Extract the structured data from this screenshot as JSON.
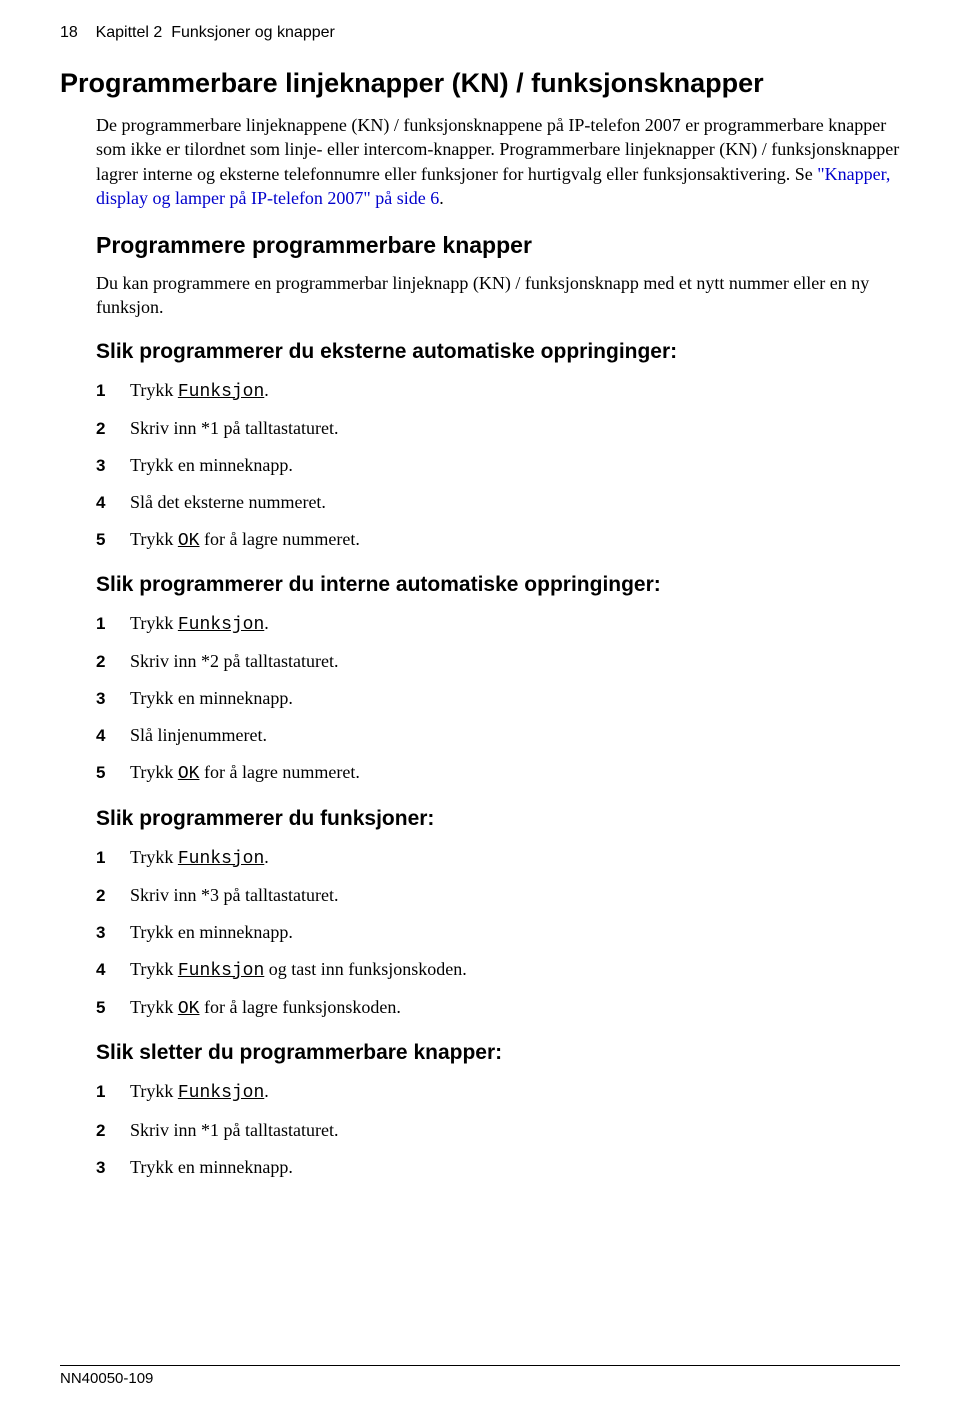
{
  "header": {
    "page_num": "18",
    "chapter": "Kapittel 2",
    "chapter_title": "Funksjoner og knapper"
  },
  "h1": "Programmerbare linjeknapper (KN) / funksjonsknapper",
  "intro": {
    "t1": "De programmerbare linjeknappene (KN) / funksjonsknappene på IP-telefon 2007 er programmerbare knapper som ikke er tilordnet som linje- eller intercom-knapper. Programmerbare linjeknapper (KN) / funksjonsknapper lagrer interne og eksterne telefonnumre eller funksjoner for hurtigvalg eller funksjonsaktivering. Se ",
    "link": "\"Knapper, display og lamper på IP-telefon 2007\" på side 6",
    "t2": "."
  },
  "h2": "Programmere programmerbare knapper",
  "p2": "Du kan programmere en programmerbar linjeknapp (KN) / funksjonsknapp med et nytt nummer eller en ny funksjon.",
  "sections": [
    {
      "title": "Slik programmerer du eksterne automatiske oppringinger:",
      "steps": [
        {
          "pre": "Trykk ",
          "key": "Funksjon",
          "post": "."
        },
        {
          "pre": "Skriv inn *1 på talltastaturet.",
          "key": "",
          "post": ""
        },
        {
          "pre": "Trykk en minneknapp.",
          "key": "",
          "post": ""
        },
        {
          "pre": "Slå det eksterne nummeret.",
          "key": "",
          "post": ""
        },
        {
          "pre": "Trykk ",
          "key": "OK",
          "post": " for å lagre nummeret."
        }
      ]
    },
    {
      "title": "Slik programmerer du interne automatiske oppringinger:",
      "steps": [
        {
          "pre": "Trykk ",
          "key": "Funksjon",
          "post": "."
        },
        {
          "pre": "Skriv inn *2 på talltastaturet.",
          "key": "",
          "post": ""
        },
        {
          "pre": "Trykk en minneknapp.",
          "key": "",
          "post": ""
        },
        {
          "pre": "Slå linjenummeret.",
          "key": "",
          "post": ""
        },
        {
          "pre": "Trykk ",
          "key": "OK",
          "post": " for å lagre nummeret."
        }
      ]
    },
    {
      "title": "Slik programmerer du funksjoner:",
      "steps": [
        {
          "pre": "Trykk ",
          "key": "Funksjon",
          "post": "."
        },
        {
          "pre": "Skriv inn *3 på talltastaturet.",
          "key": "",
          "post": ""
        },
        {
          "pre": "Trykk en minneknapp.",
          "key": "",
          "post": ""
        },
        {
          "pre": "Trykk ",
          "key": "Funksjon",
          "post": " og tast inn funksjonskoden."
        },
        {
          "pre": "Trykk ",
          "key": "OK",
          "post": " for å lagre funksjonskoden."
        }
      ]
    },
    {
      "title": "Slik sletter du programmerbare knapper:",
      "steps": [
        {
          "pre": "Trykk ",
          "key": "Funksjon",
          "post": "."
        },
        {
          "pre": "Skriv inn *1 på talltastaturet.",
          "key": "",
          "post": ""
        },
        {
          "pre": "Trykk en minneknapp.",
          "key": "",
          "post": ""
        }
      ]
    }
  ],
  "footer": "NN40050-109"
}
